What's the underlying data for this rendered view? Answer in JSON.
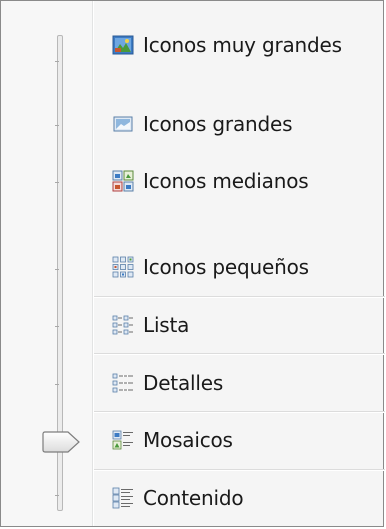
{
  "view_menu": {
    "items": [
      {
        "label": "Iconos muy grandes",
        "icon": "extra-large-icons-icon"
      },
      {
        "label": "Iconos grandes",
        "icon": "large-icons-icon"
      },
      {
        "label": "Iconos medianos",
        "icon": "medium-icons-icon"
      },
      {
        "label": "Iconos pequeños",
        "icon": "small-icons-icon"
      },
      {
        "label": "Lista",
        "icon": "list-icon"
      },
      {
        "label": "Detalles",
        "icon": "details-icon"
      },
      {
        "label": "Mosaicos",
        "icon": "tiles-icon"
      },
      {
        "label": "Contenido",
        "icon": "content-icon"
      }
    ],
    "selected": "Mosaicos"
  },
  "colors": {
    "border": "#8a8a8a",
    "background": "#f5f5f5",
    "separator": "#dcdcdc",
    "icon_blue": "#3c7bc4",
    "icon_green": "#4a9a3a"
  }
}
